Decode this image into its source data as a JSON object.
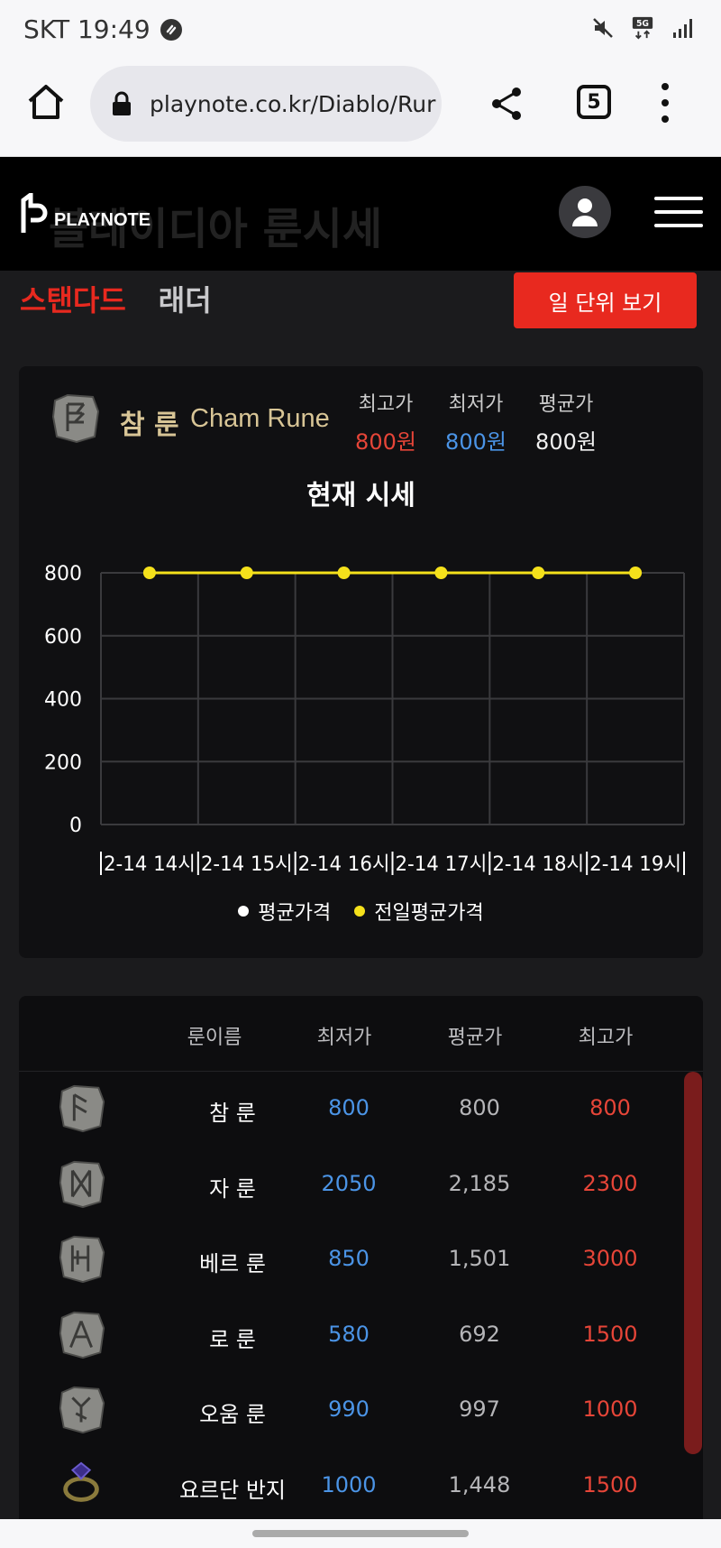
{
  "status_bar": {
    "carrier_time": "SKT 19:49",
    "network": "5G"
  },
  "browser": {
    "url": "playnote.co.kr/Diablo/Rur",
    "tab_count": "5"
  },
  "site": {
    "logo_text": "PLAYNOTE",
    "ghost_title": "블레이디아 룬시세"
  },
  "tabs": {
    "standard": "스탠다드",
    "ladder": "래더"
  },
  "daily_view_button": "일 단위 보기",
  "rune_card": {
    "name_ko": "참 룬",
    "name_en": "Cham Rune",
    "max_label": "최고가",
    "min_label": "최저가",
    "avg_label": "평균가",
    "max_value": "800원",
    "min_value": "800원",
    "avg_value": "800원",
    "chart_title": "현재 시세"
  },
  "chart_data": {
    "type": "line",
    "title": "현재 시세",
    "categories": [
      "2-14 14시",
      "2-14 15시",
      "2-14 16시",
      "2-14 17시",
      "2-14 18시",
      "2-14 19시"
    ],
    "y_ticks": [
      "800",
      "600",
      "400",
      "200",
      "0"
    ],
    "ylim": [
      0,
      800
    ],
    "grid": true,
    "legend_position": "bottom",
    "series": [
      {
        "name": "평균가격",
        "color": "#ffffff",
        "values": []
      },
      {
        "name": "전일평균가격",
        "color": "#f5e11b",
        "values": [
          800,
          800,
          800,
          800,
          800,
          800
        ]
      }
    ]
  },
  "table": {
    "headers": [
      "룬이름",
      "최저가",
      "평균가",
      "최고가"
    ],
    "rows": [
      {
        "name": "참 룬",
        "min": "800",
        "avg": "800",
        "max": "800"
      },
      {
        "name": "자 룬",
        "min": "2050",
        "avg": "2,185",
        "max": "2300"
      },
      {
        "name": "베르 룬",
        "min": "850",
        "avg": "1,501",
        "max": "3000"
      },
      {
        "name": "로 룬",
        "min": "580",
        "avg": "692",
        "max": "1500"
      },
      {
        "name": "오움 룬",
        "min": "990",
        "avg": "997",
        "max": "1000"
      },
      {
        "name": "요르단 반지",
        "min": "1000",
        "avg": "1,448",
        "max": "1500"
      }
    ]
  }
}
